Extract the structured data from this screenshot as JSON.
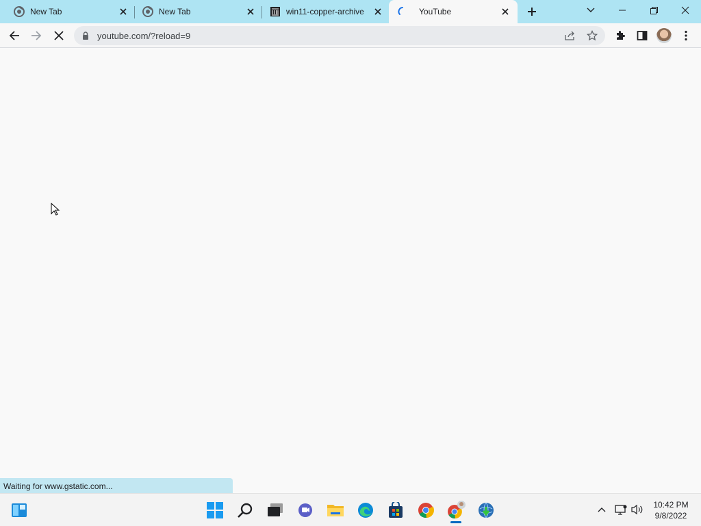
{
  "browser": {
    "tabs": [
      {
        "title": "New Tab",
        "favicon": "chrome-icon"
      },
      {
        "title": "New Tab",
        "favicon": "chrome-icon"
      },
      {
        "title": "win11-copper-archive",
        "favicon": "archive-building-icon"
      },
      {
        "title": "YouTube",
        "favicon": "loading-spinner-icon",
        "active": true
      }
    ],
    "new_tab_icon": "plus-icon",
    "window_controls": [
      "chevron-down-icon",
      "minimize-icon",
      "restore-icon",
      "close-icon"
    ]
  },
  "toolbar": {
    "url": "youtube.com/?reload=9",
    "back_icon": "back-arrow-icon",
    "forward_icon": "forward-arrow-icon",
    "stop_icon": "stop-icon",
    "lock_icon": "lock-icon",
    "share_icon": "share-icon",
    "bookmark_icon": "star-icon",
    "extensions_icon": "puzzle-icon",
    "sidepanel_icon": "side-panel-icon",
    "profile_icon": "avatar",
    "menu_icon": "kebab-menu-icon"
  },
  "status": {
    "text": "Waiting for www.gstatic.com..."
  },
  "taskbar": {
    "apps": [
      "start-icon",
      "search-icon",
      "task-view-icon",
      "chat-icon",
      "file-explorer-icon",
      "edge-icon",
      "store-icon",
      "chrome-icon",
      "chrome-profile-icon",
      "idm-icon"
    ],
    "time": "10:42 PM",
    "date": "9/8/2022",
    "accent": "#0067c0"
  },
  "colors": {
    "tabstrip": "#aee4f3",
    "toolbar": "#f7f7f7",
    "page": "#f9f9f9"
  }
}
